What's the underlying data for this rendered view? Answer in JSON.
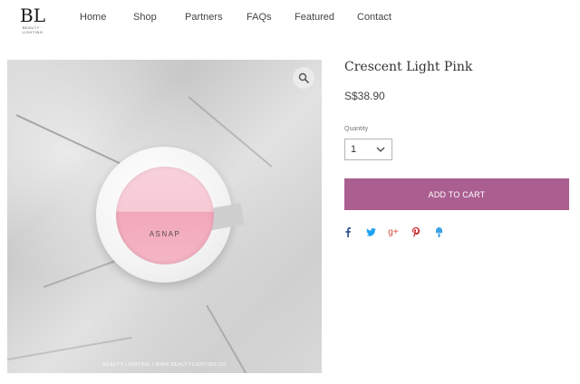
{
  "header": {
    "logo": {
      "main": "BL",
      "sub": "BEAUTY · LIGHTING"
    },
    "nav": [
      "Home",
      "Shop",
      "Partners",
      "FAQs",
      "Featured",
      "Contact"
    ]
  },
  "product": {
    "title": "Crescent Light Pink",
    "price": "S$38.90",
    "quantity_label": "Quantity",
    "quantity_value": "1",
    "add_to_cart": "ADD TO CART",
    "image": {
      "brand_text": "ASNAP",
      "watermark": "BEAUTY LIGHTING | WWW.BEAUTYLIGHTING.CO"
    }
  },
  "share": [
    {
      "name": "facebook-icon",
      "glyph": "f",
      "color": "#3b5998"
    },
    {
      "name": "twitter-icon",
      "glyph": "🐦",
      "color": "#1da1f2"
    },
    {
      "name": "google-plus-icon",
      "glyph": "g+",
      "color": "#dd4b39"
    },
    {
      "name": "pinterest-icon",
      "glyph": "P",
      "color": "#cb2027"
    },
    {
      "name": "fancy-icon",
      "glyph": "▲",
      "color": "#3aa3e3"
    }
  ],
  "colors": {
    "accent": "#ab5e90",
    "text": "#333333"
  }
}
